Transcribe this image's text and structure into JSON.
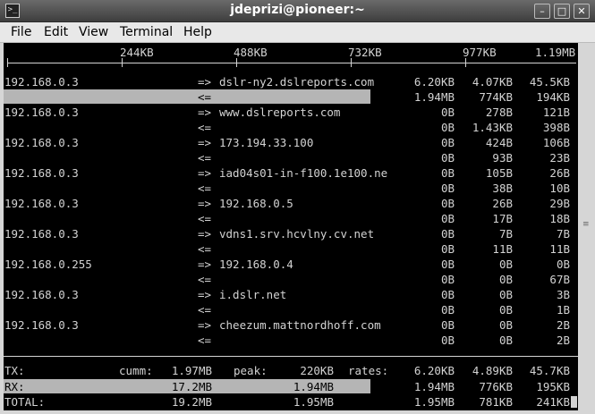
{
  "window": {
    "title": "jdeprizi@pioneer:~",
    "icon": "terminal-icon"
  },
  "window_buttons": {
    "minimize": "–",
    "maximize": "□",
    "close": "✕"
  },
  "menu": [
    "File",
    "Edit",
    "View",
    "Terminal",
    "Help"
  ],
  "scale": [
    "244KB",
    "488KB",
    "732KB",
    "977KB",
    "1.19MB"
  ],
  "rows": [
    {
      "src": "192.168.0.3",
      "out_dst": "dslr-ny2.dslreports.com",
      "out_rates": [
        "6.20KB",
        "4.07KB",
        "45.5KB"
      ],
      "in_rates": [
        "1.94MB",
        "774KB",
        "194KB"
      ]
    },
    {
      "src": "192.168.0.3",
      "out_dst": "www.dslreports.com",
      "out_rates": [
        "0B",
        "278B",
        "121B"
      ],
      "in_rates": [
        "0B",
        "1.43KB",
        "398B"
      ]
    },
    {
      "src": "192.168.0.3",
      "out_dst": "173.194.33.100",
      "out_rates": [
        "0B",
        "424B",
        "106B"
      ],
      "in_rates": [
        "0B",
        "93B",
        "23B"
      ]
    },
    {
      "src": "192.168.0.3",
      "out_dst": "iad04s01-in-f100.1e100.ne",
      "out_rates": [
        "0B",
        "105B",
        "26B"
      ],
      "in_rates": [
        "0B",
        "38B",
        "10B"
      ]
    },
    {
      "src": "192.168.0.3",
      "out_dst": "192.168.0.5",
      "out_rates": [
        "0B",
        "26B",
        "29B"
      ],
      "in_rates": [
        "0B",
        "17B",
        "18B"
      ]
    },
    {
      "src": "192.168.0.3",
      "out_dst": "vdns1.srv.hcvlny.cv.net",
      "out_rates": [
        "0B",
        "7B",
        "7B"
      ],
      "in_rates": [
        "0B",
        "11B",
        "11B"
      ]
    },
    {
      "src": "192.168.0.255",
      "out_dst": "192.168.0.4",
      "out_rates": [
        "0B",
        "0B",
        "0B"
      ],
      "in_rates": [
        "0B",
        "0B",
        "67B"
      ]
    },
    {
      "src": "192.168.0.3",
      "out_dst": "i.dslr.net",
      "out_rates": [
        "0B",
        "0B",
        "3B"
      ],
      "in_rates": [
        "0B",
        "0B",
        "1B"
      ]
    },
    {
      "src": "192.168.0.3",
      "out_dst": "cheezum.mattnordhoff.com",
      "out_rates": [
        "0B",
        "0B",
        "2B"
      ],
      "in_rates": [
        "0B",
        "0B",
        "2B"
      ]
    }
  ],
  "arrows": {
    "out": "=>",
    "in": "<="
  },
  "totals": {
    "cumm_label": "cumm:",
    "peak_label": "peak:",
    "rates_label": "rates:",
    "tx": {
      "label": "TX:",
      "cumm": "1.97MB",
      "peak": "220KB",
      "rates": [
        "6.20KB",
        "4.89KB",
        "45.7KB"
      ]
    },
    "rx": {
      "label": "RX:",
      "cumm": "17.2MB",
      "peak": "1.94MB",
      "rates": [
        "1.94MB",
        "776KB",
        "195KB"
      ]
    },
    "total": {
      "label": "TOTAL:",
      "cumm": "19.2MB",
      "peak": "1.95MB",
      "rates": [
        "1.95MB",
        "781KB",
        "241KB"
      ]
    }
  },
  "traffic_bars": {
    "row1_in_fraction": 0.63,
    "rx_fraction": 0.63
  },
  "colors": {
    "terminal_bg": "#000000",
    "terminal_fg": "#d3d3d3",
    "bar": "#b5b5b5"
  }
}
